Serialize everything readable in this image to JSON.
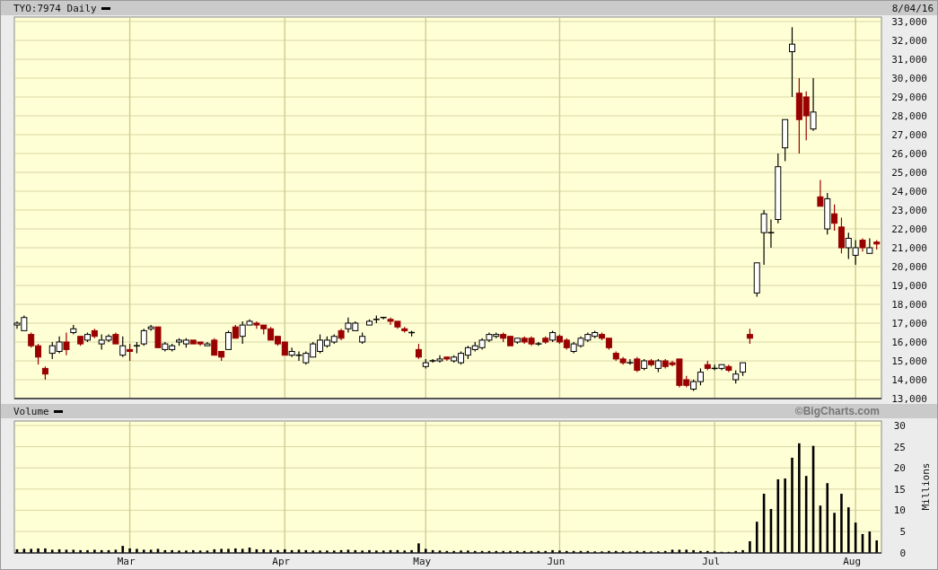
{
  "header": {
    "title": "TYO:7974 Daily",
    "date": "8/04/16"
  },
  "price_panel": {
    "chart_data": {
      "type": "candlestick",
      "grid": true,
      "ylim": [
        13000,
        33000
      ],
      "yticks": [
        {
          "value": 13000,
          "label": "13,000"
        },
        {
          "value": 14000,
          "label": "14,000"
        },
        {
          "value": 15000,
          "label": "15,000"
        },
        {
          "value": 16000,
          "label": "16,000"
        },
        {
          "value": 17000,
          "label": "17,000"
        },
        {
          "value": 18000,
          "label": "18,000"
        },
        {
          "value": 19000,
          "label": "19,000"
        },
        {
          "value": 20000,
          "label": "20,000"
        },
        {
          "value": 21000,
          "label": "21,000"
        },
        {
          "value": 22000,
          "label": "22,000"
        },
        {
          "value": 23000,
          "label": "23,000"
        },
        {
          "value": 24000,
          "label": "24,000"
        },
        {
          "value": 25000,
          "label": "25,000"
        },
        {
          "value": 26000,
          "label": "26,000"
        },
        {
          "value": 27000,
          "label": "27,000"
        },
        {
          "value": 28000,
          "label": "28,000"
        },
        {
          "value": 29000,
          "label": "29,000"
        },
        {
          "value": 30000,
          "label": "30,000"
        },
        {
          "value": 31000,
          "label": "31,000"
        },
        {
          "value": 32000,
          "label": "32,000"
        },
        {
          "value": 33000,
          "label": "33,000"
        }
      ],
      "categories": [
        null,
        null,
        null,
        null,
        null,
        null,
        null,
        null,
        null,
        null,
        null,
        null,
        null,
        null,
        null,
        null,
        null,
        null,
        null,
        null,
        null,
        null,
        null,
        null,
        null,
        null,
        null,
        null,
        null,
        null,
        null,
        null,
        null,
        null,
        null,
        null,
        null,
        null,
        null,
        null,
        null,
        null,
        null,
        null,
        null,
        null,
        null,
        null,
        null,
        null,
        null,
        null,
        null,
        null,
        null,
        null,
        null,
        null,
        null,
        null,
        null,
        null,
        null,
        null,
        null,
        null,
        null,
        null,
        null,
        null,
        null,
        null,
        null,
        null,
        null,
        null,
        null,
        null,
        null,
        null,
        null,
        null,
        null,
        null,
        null,
        null,
        null,
        null,
        null,
        null,
        null,
        null,
        null,
        null,
        null,
        null,
        null,
        null,
        null,
        null,
        null,
        null,
        null,
        null,
        null,
        null,
        null,
        null,
        null,
        null,
        null,
        null,
        null,
        null,
        null,
        null,
        null,
        null,
        null,
        null,
        null,
        null,
        null
      ],
      "ohlc": [
        [
          16900,
          17100,
          16700,
          17000
        ],
        [
          16600,
          17400,
          16600,
          17300
        ],
        [
          16400,
          16500,
          15700,
          15800
        ],
        [
          15800,
          15900,
          14800,
          15200
        ],
        [
          14600,
          14700,
          14000,
          14300
        ],
        [
          15400,
          16000,
          15100,
          15800
        ],
        [
          15500,
          16300,
          15400,
          16000
        ],
        [
          16000,
          16500,
          15300,
          15600
        ],
        [
          16500,
          16900,
          16400,
          16700
        ],
        [
          16300,
          16300,
          15800,
          15900
        ],
        [
          16100,
          16500,
          16000,
          16400
        ],
        [
          16600,
          16700,
          16200,
          16300
        ],
        [
          15900,
          16400,
          15600,
          16100
        ],
        [
          16100,
          16400,
          16000,
          16300
        ],
        [
          16400,
          16500,
          15900,
          15900
        ],
        [
          15300,
          16300,
          15200,
          15800
        ],
        [
          15600,
          15900,
          15000,
          15500
        ],
        [
          15800,
          16000,
          15400,
          15800
        ],
        [
          15900,
          16700,
          15800,
          16600
        ],
        [
          16700,
          16900,
          16600,
          16800
        ],
        [
          16800,
          16800,
          15700,
          15700
        ],
        [
          15600,
          16000,
          15500,
          15900
        ],
        [
          15600,
          15900,
          15500,
          15800
        ],
        [
          16000,
          16200,
          15800,
          16100
        ],
        [
          15900,
          16200,
          15700,
          16100
        ],
        [
          16100,
          16100,
          15900,
          15900
        ],
        [
          16000,
          16000,
          15800,
          15900
        ],
        [
          15800,
          16000,
          15800,
          15900
        ],
        [
          16100,
          16200,
          15300,
          15300
        ],
        [
          15500,
          15500,
          15000,
          15200
        ],
        [
          15600,
          16600,
          15600,
          16500
        ],
        [
          16800,
          16900,
          16200,
          16200
        ],
        [
          16300,
          17100,
          15900,
          16900
        ],
        [
          16900,
          17200,
          16900,
          17100
        ],
        [
          17000,
          17100,
          16700,
          16900
        ],
        [
          16900,
          16900,
          16400,
          16700
        ],
        [
          16700,
          16800,
          16100,
          16100
        ],
        [
          16300,
          16300,
          15800,
          15900
        ],
        [
          16000,
          16000,
          15300,
          15300
        ],
        [
          15300,
          15700,
          15200,
          15500
        ],
        [
          15300,
          15500,
          15000,
          15300
        ],
        [
          14900,
          15500,
          14800,
          15400
        ],
        [
          15200,
          16000,
          15200,
          15900
        ],
        [
          15500,
          16400,
          15400,
          16100
        ],
        [
          15800,
          16300,
          15700,
          16100
        ],
        [
          16000,
          16400,
          15900,
          16300
        ],
        [
          16600,
          16700,
          16100,
          16200
        ],
        [
          16700,
          17300,
          16500,
          17000
        ],
        [
          16600,
          17100,
          16600,
          17000
        ],
        [
          16000,
          16500,
          15900,
          16300
        ],
        [
          16900,
          17200,
          16900,
          17100
        ],
        [
          17200,
          17400,
          17000,
          17200
        ],
        [
          17300,
          17300,
          17200,
          17300
        ],
        [
          17200,
          17300,
          16900,
          17100
        ],
        [
          17100,
          17100,
          16700,
          16800
        ],
        [
          16700,
          16800,
          16500,
          16600
        ],
        [
          16500,
          16600,
          16300,
          16500
        ],
        [
          15600,
          15900,
          15100,
          15200
        ],
        [
          14700,
          15100,
          14600,
          14900
        ],
        [
          15000,
          15100,
          14900,
          15000
        ],
        [
          15000,
          15300,
          14900,
          15100
        ],
        [
          15200,
          15200,
          15000,
          15100
        ],
        [
          15000,
          15300,
          14900,
          15200
        ],
        [
          14900,
          15500,
          14800,
          15400
        ],
        [
          15300,
          15800,
          15100,
          15700
        ],
        [
          15600,
          16000,
          15500,
          15800
        ],
        [
          15700,
          16200,
          15600,
          16100
        ],
        [
          16100,
          16500,
          16000,
          16400
        ],
        [
          16300,
          16500,
          16200,
          16400
        ],
        [
          16400,
          16500,
          16000,
          16200
        ],
        [
          16300,
          16300,
          15800,
          15800
        ],
        [
          16000,
          16200,
          15900,
          16200
        ],
        [
          16200,
          16300,
          15900,
          16000
        ],
        [
          16200,
          16300,
          15800,
          15900
        ],
        [
          15900,
          16000,
          15800,
          15900
        ],
        [
          16200,
          16300,
          15900,
          16000
        ],
        [
          16100,
          16600,
          16000,
          16500
        ],
        [
          16300,
          16400,
          15900,
          16000
        ],
        [
          16100,
          16200,
          15600,
          15700
        ],
        [
          15500,
          16000,
          15400,
          15900
        ],
        [
          15800,
          16300,
          15700,
          16200
        ],
        [
          16100,
          16500,
          16000,
          16400
        ],
        [
          16300,
          16600,
          16200,
          16500
        ],
        [
          16400,
          16500,
          16100,
          16200
        ],
        [
          16200,
          16200,
          15600,
          15700
        ],
        [
          15400,
          15500,
          15000,
          15100
        ],
        [
          15100,
          15200,
          14800,
          14900
        ],
        [
          14900,
          15100,
          14800,
          14900
        ],
        [
          15100,
          15200,
          14400,
          14500
        ],
        [
          14600,
          15100,
          14500,
          15000
        ],
        [
          15000,
          15100,
          14700,
          14800
        ],
        [
          14600,
          15100,
          14400,
          15000
        ],
        [
          15000,
          15100,
          14600,
          14700
        ],
        [
          14900,
          15000,
          14700,
          14800
        ],
        [
          15100,
          15100,
          13600,
          13700
        ],
        [
          14000,
          14200,
          13600,
          13700
        ],
        [
          13500,
          14000,
          13400,
          13900
        ],
        [
          13900,
          14600,
          13700,
          14400
        ],
        [
          14800,
          15000,
          14500,
          14600
        ],
        [
          14600,
          14800,
          14500,
          14600
        ],
        [
          14600,
          14800,
          14500,
          14800
        ],
        [
          14700,
          14800,
          14400,
          14500
        ],
        [
          14000,
          14500,
          13800,
          14300
        ],
        [
          14400,
          14900,
          14200,
          14900
        ],
        [
          16400,
          16700,
          15900,
          16200
        ],
        [
          18600,
          20200,
          18400,
          20200
        ],
        [
          21800,
          23000,
          20100,
          22800
        ],
        [
          21800,
          22500,
          21000,
          21800
        ],
        [
          22500,
          26000,
          22300,
          25300
        ],
        [
          26300,
          27800,
          25600,
          27800
        ],
        [
          31400,
          32700,
          29000,
          31800
        ],
        [
          29200,
          30000,
          26000,
          27800
        ],
        [
          29000,
          29300,
          26700,
          28000
        ],
        [
          27300,
          30000,
          27200,
          28200
        ],
        [
          23700,
          24600,
          23200,
          23200
        ],
        [
          22000,
          23900,
          21700,
          23600
        ],
        [
          22800,
          23300,
          21900,
          22300
        ],
        [
          22100,
          22600,
          20700,
          21000
        ],
        [
          21000,
          21800,
          20400,
          21500
        ],
        [
          20600,
          21400,
          20100,
          21000
        ],
        [
          21400,
          21500,
          20800,
          21000
        ],
        [
          20700,
          21500,
          20700,
          21000
        ],
        [
          21300,
          21400,
          20900,
          21200
        ]
      ]
    }
  },
  "volume_panel": {
    "title": "Volume",
    "credit": "©BigCharts.com",
    "chart_data": {
      "type": "bar",
      "grid": true,
      "ylabel": "Millions",
      "ylim": [
        0,
        30
      ],
      "yticks": [
        0,
        5,
        10,
        15,
        20,
        25,
        30
      ],
      "categories": [
        null,
        null,
        null,
        null,
        null,
        null,
        null,
        null,
        null,
        null,
        null,
        null,
        null,
        null,
        null,
        null,
        "Mar",
        null,
        null,
        null,
        null,
        null,
        null,
        null,
        null,
        null,
        null,
        null,
        null,
        null,
        null,
        null,
        null,
        null,
        null,
        null,
        null,
        null,
        "Apr",
        null,
        null,
        null,
        null,
        null,
        null,
        null,
        null,
        null,
        null,
        null,
        null,
        null,
        null,
        null,
        null,
        null,
        null,
        null,
        "May",
        null,
        null,
        null,
        null,
        null,
        null,
        null,
        null,
        null,
        null,
        null,
        null,
        null,
        null,
        null,
        null,
        null,
        null,
        "Jun",
        null,
        null,
        null,
        null,
        null,
        null,
        null,
        null,
        null,
        null,
        null,
        null,
        null,
        null,
        null,
        null,
        null,
        null,
        null,
        null,
        null,
        "Jul",
        null,
        null,
        null,
        null,
        null,
        null,
        null,
        null,
        null,
        null,
        null,
        null,
        null,
        null,
        null,
        null,
        null,
        null,
        null,
        "Aug",
        null,
        null,
        null
      ],
      "values": [
        0.8,
        0.9,
        0.9,
        1.0,
        1.0,
        0.7,
        0.8,
        0.7,
        0.7,
        0.6,
        0.6,
        0.7,
        0.6,
        0.6,
        0.7,
        1.6,
        1.0,
        0.9,
        0.7,
        0.7,
        0.9,
        0.6,
        0.6,
        0.5,
        0.5,
        0.6,
        0.5,
        0.5,
        0.8,
        0.9,
        0.9,
        1.0,
        0.9,
        1.2,
        0.8,
        0.8,
        0.7,
        0.6,
        0.8,
        0.6,
        0.7,
        0.6,
        0.5,
        0.5,
        0.5,
        0.5,
        0.6,
        0.7,
        0.6,
        0.5,
        0.6,
        0.5,
        0.5,
        0.6,
        0.6,
        0.5,
        0.6,
        2.2,
        0.9,
        0.6,
        0.5,
        0.4,
        0.4,
        0.5,
        0.5,
        0.4,
        0.4,
        0.4,
        0.4,
        0.4,
        0.4,
        0.4,
        0.4,
        0.4,
        0.4,
        0.4,
        0.6,
        0.5,
        0.4,
        0.4,
        0.4,
        0.4,
        0.3,
        0.3,
        0.4,
        0.4,
        0.4,
        0.3,
        0.4,
        0.4,
        0.3,
        0.3,
        0.4,
        0.7,
        0.7,
        0.7,
        0.6,
        0.4,
        0.4,
        0.4,
        0.2,
        0.2,
        0.4,
        0.6,
        2.7,
        7.3,
        13.9,
        10.3,
        17.3,
        17.5,
        22.4,
        25.8,
        18.1,
        25.2,
        11.1,
        16.4,
        9.4,
        13.9,
        10.7,
        7.1,
        4.4,
        5.0,
        2.9
      ]
    }
  }
}
